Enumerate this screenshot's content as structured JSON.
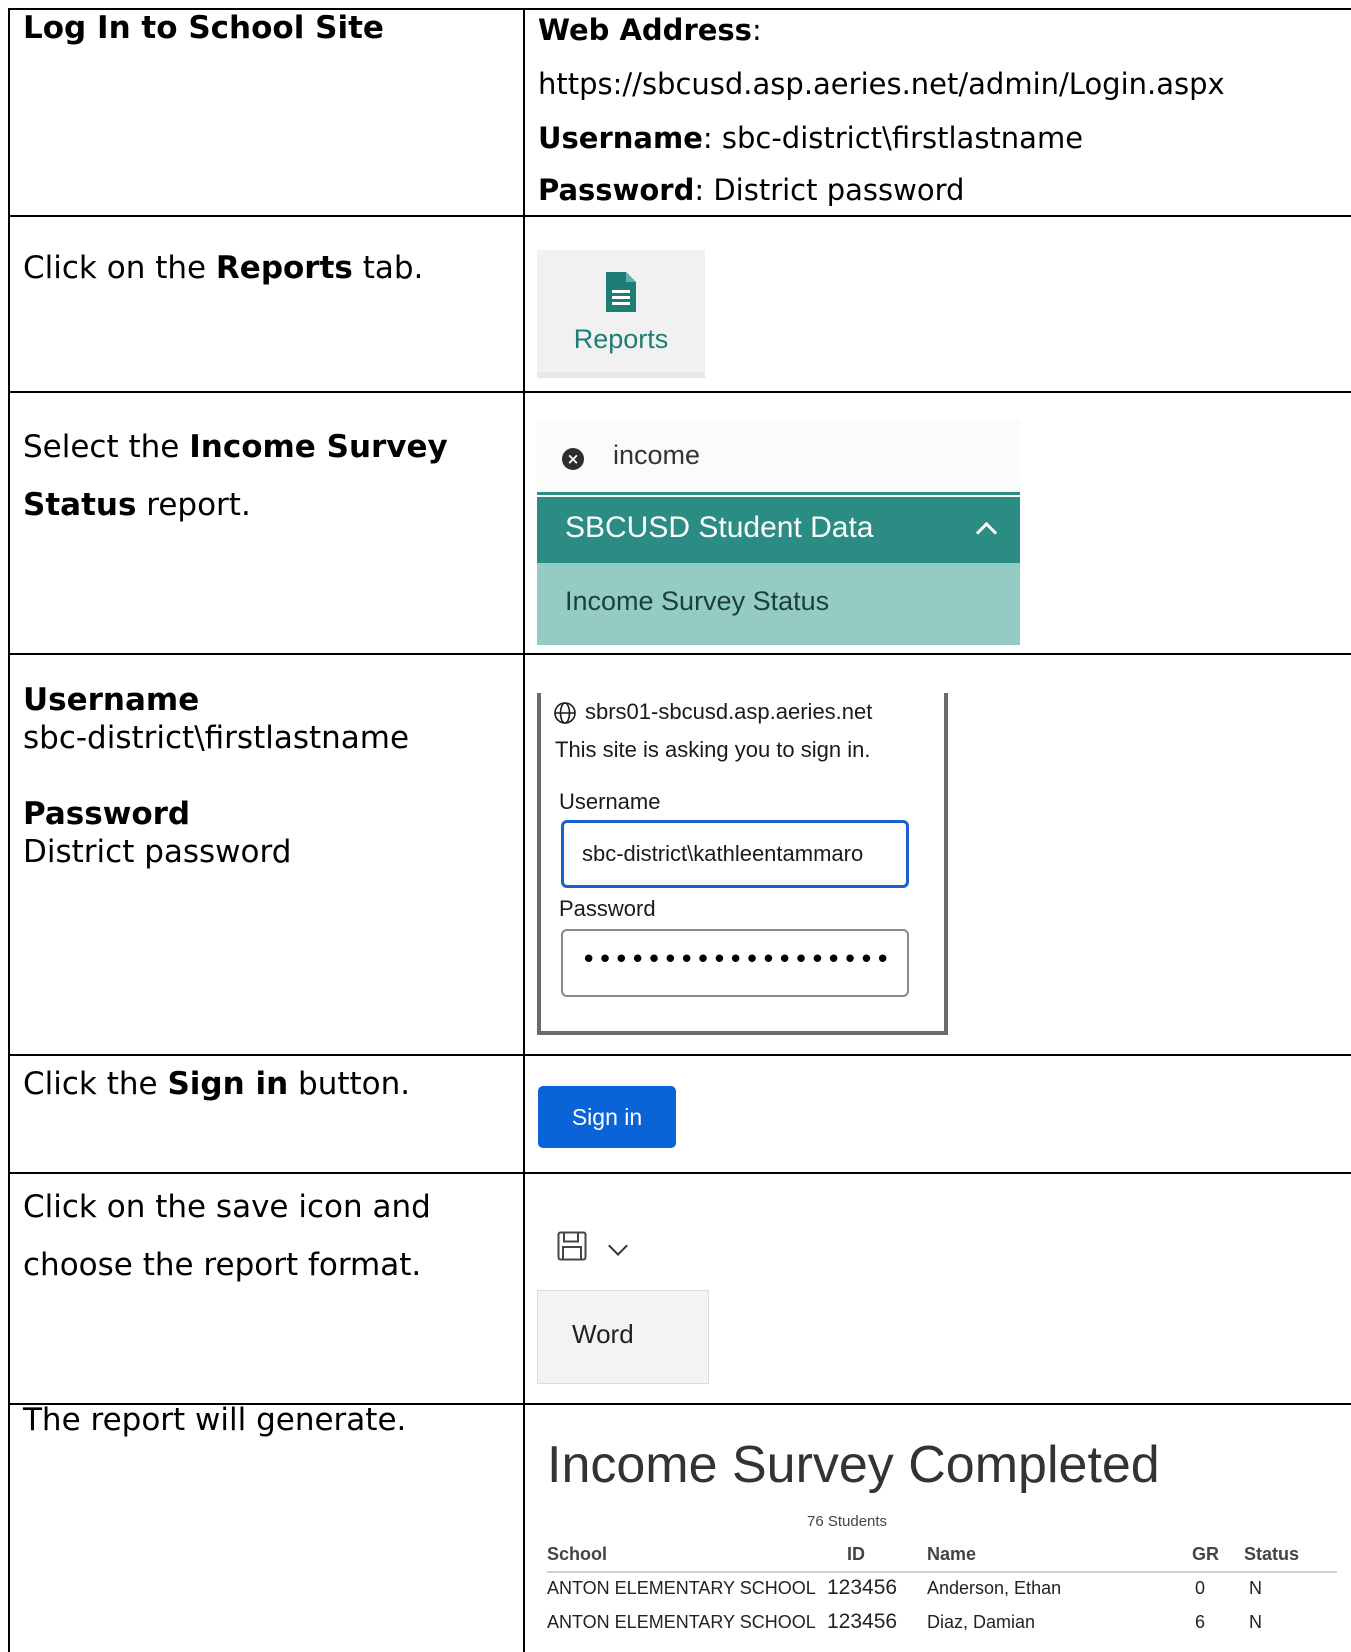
{
  "row1": {
    "left_title": "Log In to School Site",
    "web_address_label": "Web Address",
    "web_address_colon": ":",
    "url": "https://sbcusd.asp.aeries.net/admin/Login.aspx",
    "username_label": "Username",
    "username_value": ": sbc-district\\firstlastname",
    "password_label": "Password",
    "password_value": ": District password"
  },
  "row2": {
    "pre": "Click on the ",
    "bold": "Reports",
    "post": " tab.",
    "tab_label": "Reports",
    "tab_icon": "document-icon",
    "accent": "#1e7d74"
  },
  "row3": {
    "pre": "Select the ",
    "bold1": "Income Survey",
    "bold2": "Status",
    "post": " report.",
    "search_text": "income",
    "group_title": "SBCUSD Student Data",
    "item": "Income Survey Status",
    "group_color": "#2a8c82",
    "item_color": "#94cbc5"
  },
  "row4": {
    "username_label": "Username",
    "username_value": "sbc-district\\firstlastname",
    "password_label": "Password",
    "password_value": "District password",
    "dialog_host": "sbrs01-sbcusd.asp.aeries.net",
    "dialog_msg": "This site is asking you to sign in.",
    "dialog_user_label": "Username",
    "dialog_user_value": "sbc-district\\kathleentammaro",
    "dialog_pass_label": "Password",
    "dialog_pass_dots": "•••••••••••••••••••"
  },
  "row5": {
    "pre": "Click the ",
    "bold": "Sign in",
    "post": " button.",
    "button_label": "Sign in",
    "button_color": "#0a64d8"
  },
  "row6": {
    "line1": "Click on the save icon and",
    "line2": "choose the report format.",
    "menu_item": "Word"
  },
  "row7": {
    "text": "The report will generate.",
    "report_title": "Income Survey Completed",
    "report_count": "76 Students",
    "columns": [
      "School",
      "ID",
      "Name",
      "GR",
      "Status"
    ],
    "rows": [
      [
        "ANTON ELEMENTARY SCHOOL",
        "123456",
        "Anderson, Ethan",
        "0",
        "N"
      ],
      [
        "ANTON ELEMENTARY SCHOOL",
        "123456",
        "Diaz, Damian",
        "6",
        "N"
      ]
    ]
  }
}
